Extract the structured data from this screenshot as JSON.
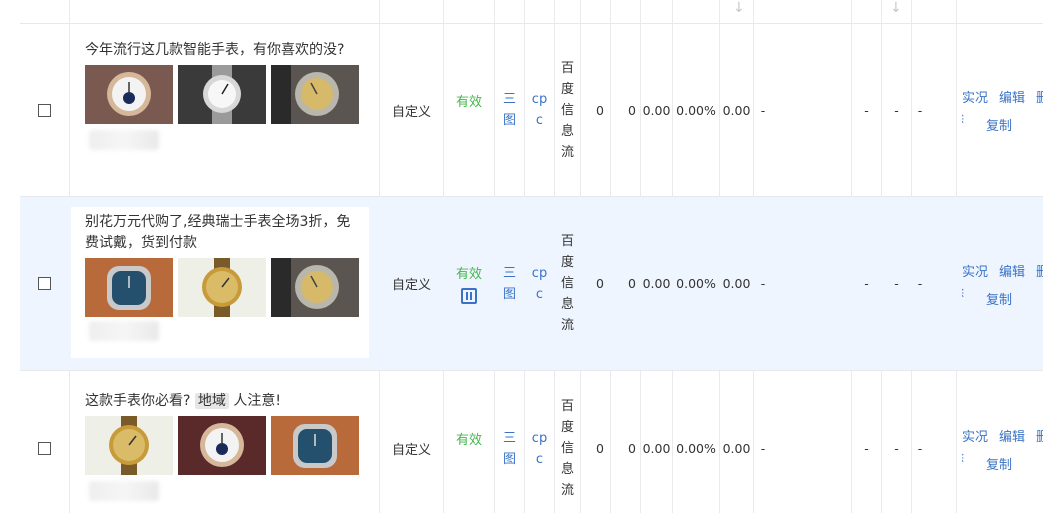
{
  "rows": [
    {
      "title": "今年流行这几款智能手表，有你喜欢的没?",
      "type": "自定义",
      "status": "有效",
      "style": "三图",
      "bid_type": "cpc",
      "channel": "百度信息流",
      "n1": "0",
      "n2": "0",
      "n3": "0.00",
      "n4": "0.00%",
      "n5": "0.00",
      "n6": "-",
      "d1": "-",
      "d2": "-",
      "d3": "-",
      "ops": [
        "实况",
        "编辑",
        "删除",
        "复制"
      ],
      "thumbs": [
        "rose-gold-moonphase-watch",
        "silver-cartier-watch",
        "gold-datejust-watch"
      ]
    },
    {
      "title": "别花万元代购了,经典瑞士手表全场3折，免费试戴，货到付款",
      "type": "自定义",
      "status": "有效",
      "style": "三图",
      "bid_type": "cpc",
      "channel": "百度信息流",
      "n1": "0",
      "n2": "0",
      "n3": "0.00",
      "n4": "0.00%",
      "n5": "0.00",
      "n6": "-",
      "d1": "-",
      "d2": "-",
      "d3": "-",
      "ops": [
        "实况",
        "编辑",
        "删除",
        "复制"
      ],
      "thumbs": [
        "blue-nautilus-watch",
        "gold-dress-watch",
        "gold-datejust-watch"
      ]
    },
    {
      "title_pre": "这款手表你必看?",
      "title_tag": "地域",
      "title_post": "人注意!",
      "type": "自定义",
      "status": "有效",
      "style": "三图",
      "bid_type": "cpc",
      "channel": "百度信息流",
      "n1": "0",
      "n2": "0",
      "n3": "0.00",
      "n4": "0.00%",
      "n5": "0.00",
      "n6": "-",
      "d1": "-",
      "d2": "-",
      "d3": "-",
      "ops": [
        "实况",
        "编辑",
        "删除",
        "复制"
      ],
      "thumbs": [
        "gold-dress-watch",
        "rose-gold-moonphase-watch",
        "blue-nautilus-watch"
      ]
    }
  ],
  "icons": {
    "sort": "sort-arrow-icon",
    "pause": "pause-icon"
  },
  "colors": {
    "link": "#3a73c5",
    "status_ok": "#41b849",
    "row_highlight": "#eff5ff"
  }
}
